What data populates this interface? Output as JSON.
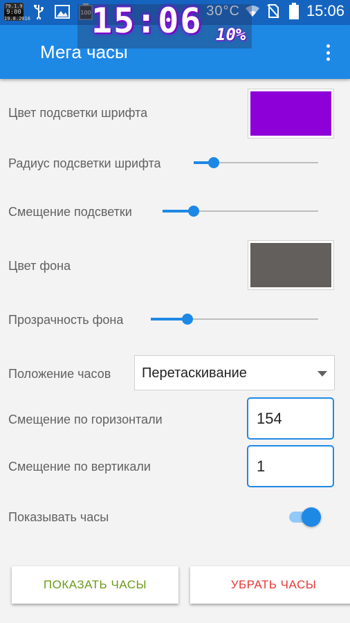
{
  "status_bar": {
    "mini_widget": {
      "top": "79.1.9",
      "time": "9:00",
      "bottom": "19.8.2016"
    },
    "battery_percent_icon": "100",
    "temperature": "30°C",
    "time": "15:06",
    "icons": [
      "phone-widget-icon",
      "usb-icon",
      "image-icon",
      "battery-widget-icon",
      "signal-widget-icon",
      "wifi-icon",
      "no-sim-icon",
      "battery-icon"
    ]
  },
  "overlay_clock": {
    "time": "15:06",
    "battery": "10%",
    "glow_color": "#9000e0"
  },
  "app_bar": {
    "title": "Мега часы",
    "menu_icon": "overflow-menu-icon"
  },
  "settings": {
    "font_glow_color": {
      "label": "Цвет подсветки шрифта",
      "color": "#8e00d8"
    },
    "font_glow_radius": {
      "label": "Радиус подсветки шрифта",
      "value": 0.16
    },
    "glow_offset": {
      "label": "Смещение подсветки",
      "value": 0.2
    },
    "bg_color": {
      "label": "Цвет фона",
      "color": "#625f5c"
    },
    "bg_transparency": {
      "label": "Прозрачность фона",
      "value": 0.22
    },
    "clock_position": {
      "label": "Положение часов",
      "value": "Перетаскивание"
    },
    "h_offset": {
      "label": "Смещение по горизонтали",
      "value": "154"
    },
    "v_offset": {
      "label": "Смещение по вертикали",
      "value": "1"
    },
    "show_clock": {
      "label": "Показывать часы",
      "on": true
    }
  },
  "buttons": {
    "show": "ПОКАЗАТЬ ЧАСЫ",
    "hide": "УБРАТЬ ЧАСЫ"
  },
  "colors": {
    "primary": "#1e88e5",
    "primary_dark": "#1565c0",
    "show_btn": "#6a9a1a",
    "hide_btn": "#e53935"
  }
}
